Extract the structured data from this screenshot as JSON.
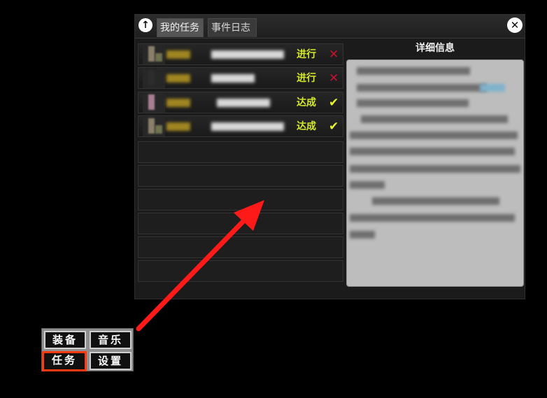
{
  "window": {
    "up_icon": "↑",
    "tabs": [
      {
        "label": "我的任务"
      },
      {
        "label": "事件日志"
      }
    ],
    "close_icon": "✕"
  },
  "quests": [
    {
      "status": "进行",
      "state_icon": "✕",
      "state": "in-progress",
      "portrait": "character"
    },
    {
      "status": "进行",
      "state_icon": "✕",
      "state": "in-progress",
      "portrait": "dark"
    },
    {
      "status": "达成",
      "state_icon": "✔",
      "state": "completed",
      "portrait": "pink"
    },
    {
      "status": "达成",
      "state_icon": "✔",
      "state": "completed",
      "portrait": "character"
    }
  ],
  "empty_slots": 6,
  "detail": {
    "title": "详细信息"
  },
  "buttons": [
    {
      "label": "装备",
      "highlighted": false
    },
    {
      "label": "音乐",
      "highlighted": false
    },
    {
      "label": "任务",
      "highlighted": true
    },
    {
      "label": "设置",
      "highlighted": false
    }
  ],
  "colors": {
    "status_text": "#d4e82a",
    "in_progress_icon": "#c8102e",
    "completed_icon": "#e8f52a",
    "highlight_border": "#ff3a10",
    "arrow": "#ff1a1a"
  }
}
